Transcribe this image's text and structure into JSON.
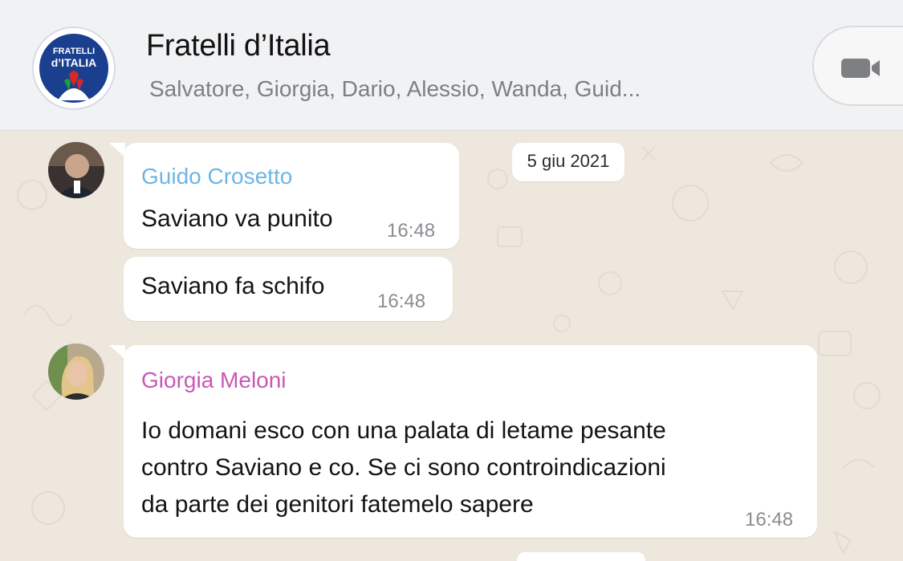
{
  "header": {
    "title": "Fratelli d’Italia",
    "members": "Salvatore, Giorgia, Dario, Alessio, Wanda, Guid...",
    "logo_text_line1": "FRATELLI",
    "logo_text_line2": "d’ITALIA",
    "call_icon": "video-camera-icon"
  },
  "date_separator": "5 giu 2021",
  "messages": [
    {
      "sender": "Guido Crosetto",
      "sender_color": "#6fb5e3",
      "text": "Saviano va punito",
      "time": "16:48"
    },
    {
      "text": "Saviano fa schifo",
      "time": "16:48"
    },
    {
      "sender": "Giorgia Meloni",
      "sender_color": "#c957b6",
      "lines": [
        "Io domani esco con una palata di letame pesante",
        "contro Saviano e co. Se ci sono controindicazioni",
        "da parte dei genitori fatemelo sapere"
      ],
      "time": "16:48"
    }
  ]
}
